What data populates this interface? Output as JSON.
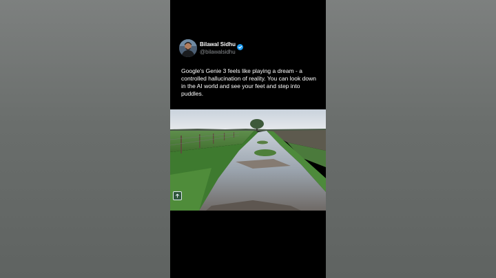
{
  "post": {
    "author_name": "Bilawal Sidhu",
    "author_handle": "@bilawalsidhu",
    "text": "Google's Genie 3 feels like playing a dream - a controlled hallucination of reality. You can look down in the AI world and see your feet and step into puddles.",
    "verified_badge_icon": "verified-badge-icon",
    "media_action_icon": "arrow-up-icon"
  },
  "colors": {
    "panel_background": "#000000",
    "side_background": "#6b6f6d",
    "verified_blue": "#1d9bf0",
    "handle_gray": "#8b8f93"
  }
}
